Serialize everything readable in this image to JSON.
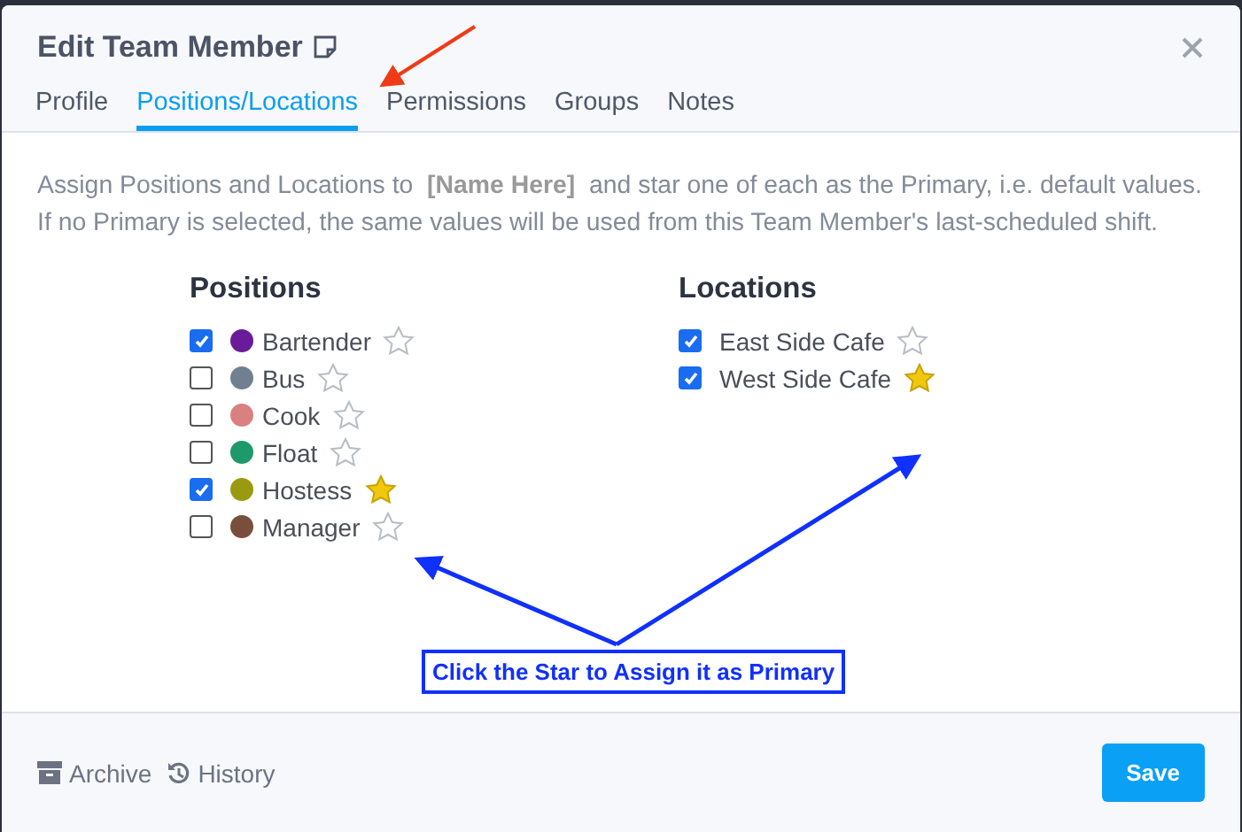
{
  "window": {
    "title": "Edit Team Member"
  },
  "tabs": [
    {
      "label": "Profile",
      "selected": false
    },
    {
      "label": "Positions/Locations",
      "selected": true
    },
    {
      "label": "Permissions",
      "selected": false
    },
    {
      "label": "Groups",
      "selected": false
    },
    {
      "label": "Notes",
      "selected": false
    }
  ],
  "description": "Assign Positions and Locations to  **[Name Here]**  and star one of each as the Primary, i.e. default values. If no Primary is selected, the same values will be used from this Team Member's last-scheduled shift.",
  "positions": {
    "heading": "Positions",
    "items": [
      {
        "label": "Bartender",
        "checked": true,
        "color": "#6a1b9a",
        "primary": false
      },
      {
        "label": "Bus",
        "checked": false,
        "color": "#708090",
        "primary": false
      },
      {
        "label": "Cook",
        "checked": false,
        "color": "#d98080",
        "primary": false
      },
      {
        "label": "Float",
        "checked": false,
        "color": "#1e9a6a",
        "primary": false
      },
      {
        "label": "Hostess",
        "checked": true,
        "color": "#9a9a10",
        "primary": true
      },
      {
        "label": "Manager",
        "checked": false,
        "color": "#7a4e3c",
        "primary": false
      }
    ]
  },
  "locations": {
    "heading": "Locations",
    "items": [
      {
        "label": "East Side Cafe",
        "checked": true,
        "primary": false
      },
      {
        "label": "West Side Cafe",
        "checked": true,
        "primary": true
      }
    ]
  },
  "callout": "Click the Star to Assign it as Primary",
  "footer": {
    "links": [
      {
        "kind": "archive",
        "label": "Archive"
      },
      {
        "kind": "history",
        "label": "History"
      }
    ],
    "save": "Save"
  }
}
